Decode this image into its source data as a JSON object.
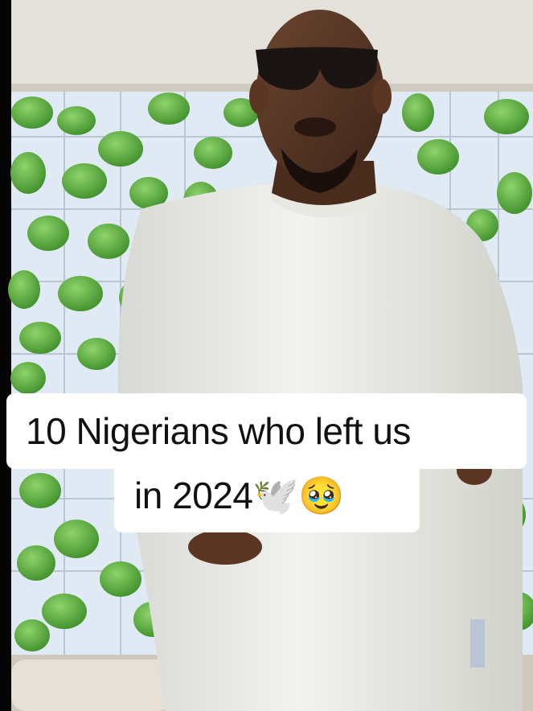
{
  "caption": {
    "line1": "10 Nigerians who left us",
    "line2": "in 2024🕊️🥹"
  }
}
